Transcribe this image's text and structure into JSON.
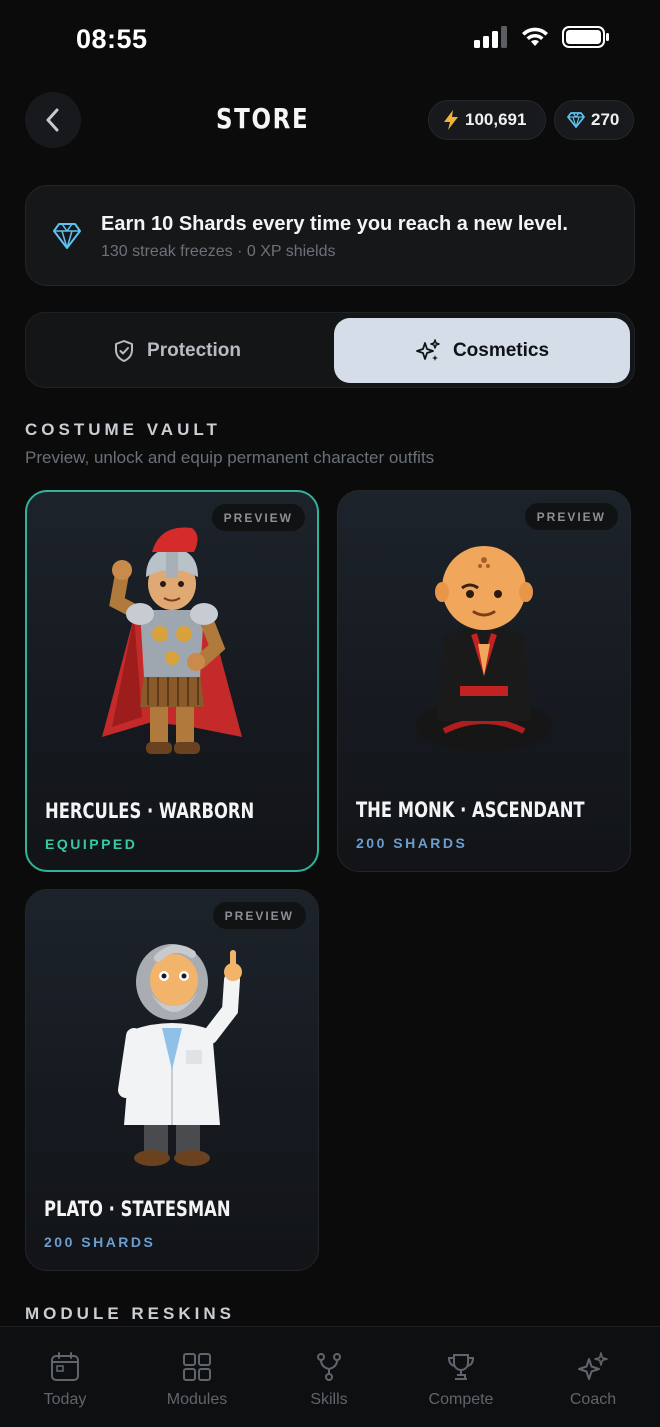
{
  "status_bar": {
    "time": "08:55"
  },
  "header": {
    "title": "STORE",
    "xp_balance": "100,691",
    "shard_balance": "270",
    "icons": {
      "back": "chevron-left-icon",
      "xp": "lightning-icon",
      "shards": "diamond-icon"
    }
  },
  "info": {
    "headline": "Earn 10 Shards every time you reach a new level.",
    "subline": "130 streak freezes · 0 XP shields",
    "icon": "diamond-icon"
  },
  "tabs": [
    {
      "label": "Protection",
      "icon": "shield-check-icon",
      "selected": false
    },
    {
      "label": "Cosmetics",
      "icon": "sparkles-icon",
      "selected": true
    }
  ],
  "costume_vault": {
    "title": "COSTUME VAULT",
    "subtitle": "Preview, unlock and equip permanent character outfits",
    "items": [
      {
        "name": "HERCULES · WARBORN",
        "status": "EQUIPPED",
        "preview_label": "PREVIEW"
      },
      {
        "name": "THE MONK · ASCENDANT",
        "status": "200 SHARDS",
        "preview_label": "PREVIEW"
      },
      {
        "name": "PLATO · STATESMAN",
        "status": "200 SHARDS",
        "preview_label": "PREVIEW"
      }
    ]
  },
  "module_reskins": {
    "title": "MODULE RESKINS"
  },
  "bottom_nav": [
    {
      "label": "Today",
      "icon": "calendar-icon"
    },
    {
      "label": "Modules",
      "icon": "grid-icon"
    },
    {
      "label": "Skills",
      "icon": "branch-icon"
    },
    {
      "label": "Compete",
      "icon": "trophy-icon"
    },
    {
      "label": "Coach",
      "icon": "sparkles-icon"
    }
  ],
  "colors": {
    "background": "#0b0b0c",
    "accent_teal": "#37c8a7",
    "price_blue": "#6b9ecf",
    "selected_tab": "#d4dde8",
    "xp_yellow": "#f2b33d",
    "shard_blue": "#5cc3f0"
  }
}
